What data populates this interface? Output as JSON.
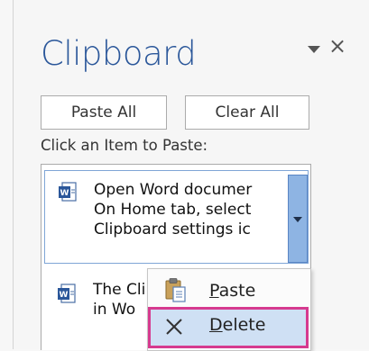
{
  "pane": {
    "title": "Clipboard",
    "paste_all_label": "Paste All",
    "clear_all_label": "Clear All",
    "click_label": "Click an Item to Paste:"
  },
  "items": [
    {
      "icon": "word-document-icon",
      "lines": [
        "Open Word documer",
        "On Home tab, select",
        "Clipboard settings ic"
      ]
    },
    {
      "icon": "word-document-icon",
      "lines": [
        "The Cli",
        "in Wo"
      ]
    }
  ],
  "context_menu": {
    "paste": {
      "first": "P",
      "rest": "aste",
      "icon": "paste-icon"
    },
    "delete": {
      "first": "D",
      "rest": "elete",
      "icon": "x-icon"
    }
  },
  "colors": {
    "title": "#2b579a",
    "selection_border": "#7fa5d6",
    "dropdown_fill": "#8eb4e3",
    "highlight_outline": "#d63a8f",
    "menu_hover": "#cfe0f4"
  }
}
